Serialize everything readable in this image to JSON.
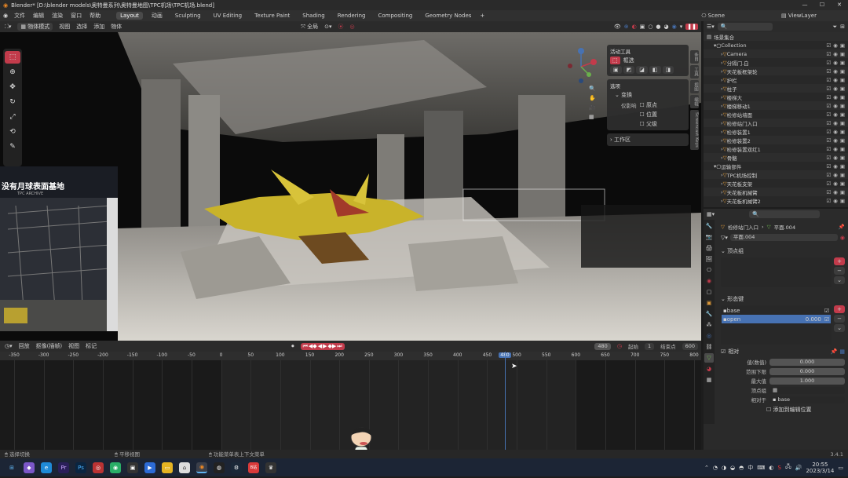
{
  "window": {
    "title": "Blender* [D:\\blender models\\奥特曼系列\\奥特曼地图\\TPC机场\\TPC机场.blend]",
    "controls": [
      "—",
      "☐",
      "✕"
    ]
  },
  "menubar": {
    "items": [
      "文件",
      "编辑",
      "渲染",
      "窗口",
      "帮助"
    ]
  },
  "workspaces": [
    "Layout",
    "动画",
    "Sculpting",
    "UV Editing",
    "Texture Paint",
    "Shading",
    "Rendering",
    "Compositing",
    "Geometry Nodes"
  ],
  "active_workspace": "Layout",
  "scene": {
    "label": "Scene",
    "view_layer": "ViewLayer"
  },
  "viewport_header": {
    "mode": "物体模式",
    "menus": [
      "视图",
      "选择",
      "添加",
      "物体"
    ],
    "transform": "全局",
    "options": "选项"
  },
  "overlay_video": {
    "caption": "没有月球表面基地",
    "sub": "TPC ARCHIVE"
  },
  "npanel": {
    "tool_title": "活动工具",
    "tool_name": "框选",
    "item_title": "选项",
    "transform_title": "变换",
    "affect_label": "仅影响",
    "affect_options": [
      "原点",
      "位置",
      "父级"
    ],
    "workspace_title": "工作区"
  },
  "npanel_tabs": [
    "条目",
    "工具",
    "视图",
    "编辑",
    "Screencast Keys"
  ],
  "outliner": {
    "title": "场景集合",
    "rows": [
      {
        "name": "Collection",
        "indent": 1
      },
      {
        "name": "Camera",
        "indent": 2
      },
      {
        "name": "分隔门.白",
        "indent": 2
      },
      {
        "name": "天花板框架轮",
        "indent": 2
      },
      {
        "name": "护栏",
        "indent": 2
      },
      {
        "name": "柱子",
        "indent": 2
      },
      {
        "name": "楼梯大",
        "indent": 2
      },
      {
        "name": "楼梯移动1",
        "indent": 2
      },
      {
        "name": "检修站墙面",
        "indent": 2
      },
      {
        "name": "检修站门入口",
        "indent": 2
      },
      {
        "name": "检修装置1",
        "indent": 2
      },
      {
        "name": "检修装置2",
        "indent": 2
      },
      {
        "name": "检修装置双红1",
        "indent": 2
      },
      {
        "name": "骨骼",
        "indent": 2
      },
      {
        "name": "运输部件",
        "indent": 1
      },
      {
        "name": "TPC机场控制",
        "indent": 2
      },
      {
        "name": "天花板支架",
        "indent": 2
      },
      {
        "name": "天花板机械臂",
        "indent": 2
      },
      {
        "name": "天花板机械臂2",
        "indent": 2
      }
    ]
  },
  "properties": {
    "breadcrumb_object": "检修站门入口",
    "breadcrumb_data": "平面.004",
    "mesh_name": "平面.004",
    "vertex_groups_title": "顶点组",
    "shape_keys_title": "形态键",
    "shape_keys": [
      {
        "name": "base",
        "value": ""
      },
      {
        "name": "open",
        "value": "0.000"
      }
    ],
    "relative_label": "相对",
    "value_label": "值(数值)",
    "value": "0.000",
    "range_min_label": "范围下限",
    "range_min": "0.000",
    "max_label": "最大值",
    "max": "1.000",
    "vgroup_label": "顶点组",
    "relative_to_label": "相对于",
    "relative_to": "base",
    "edit_mode_label": "添加到编辑位置"
  },
  "timeline": {
    "menus": [
      "回放",
      "抠像(插帧)",
      "视图",
      "标记"
    ],
    "current_frame": "480",
    "start_label": "起始",
    "start": "1",
    "end_label": "结束点",
    "end": "600",
    "ruler": [
      "-350",
      "-300",
      "-250",
      "-200",
      "-150",
      "-100",
      "-50",
      "0",
      "50",
      "100",
      "150",
      "200",
      "250",
      "300",
      "350",
      "400",
      "450",
      "480",
      "500",
      "550",
      "600",
      "650",
      "700",
      "750",
      "800"
    ],
    "playhead": 480
  },
  "statusbar": {
    "items": [
      "选择切换",
      "平移视图",
      "功能菜单表上下文菜单"
    ],
    "version": "3.4.1"
  },
  "taskbar": {
    "icons": [
      "win-icon",
      "edge-icon",
      "premiere-icon",
      "photoshop-icon",
      "wechat-icon",
      "app-icon",
      "folder-icon",
      "app2-icon",
      "blender-icon",
      "obs-icon",
      "steam-icon",
      "bilibili-icon",
      "app3-icon"
    ],
    "lang": "中",
    "time": "20:55",
    "date": "2023/3/14"
  },
  "colors": {
    "accent": "#c23b4b",
    "selected": "#4772b3",
    "bg": "#303030",
    "playhead": "#4772b3"
  }
}
